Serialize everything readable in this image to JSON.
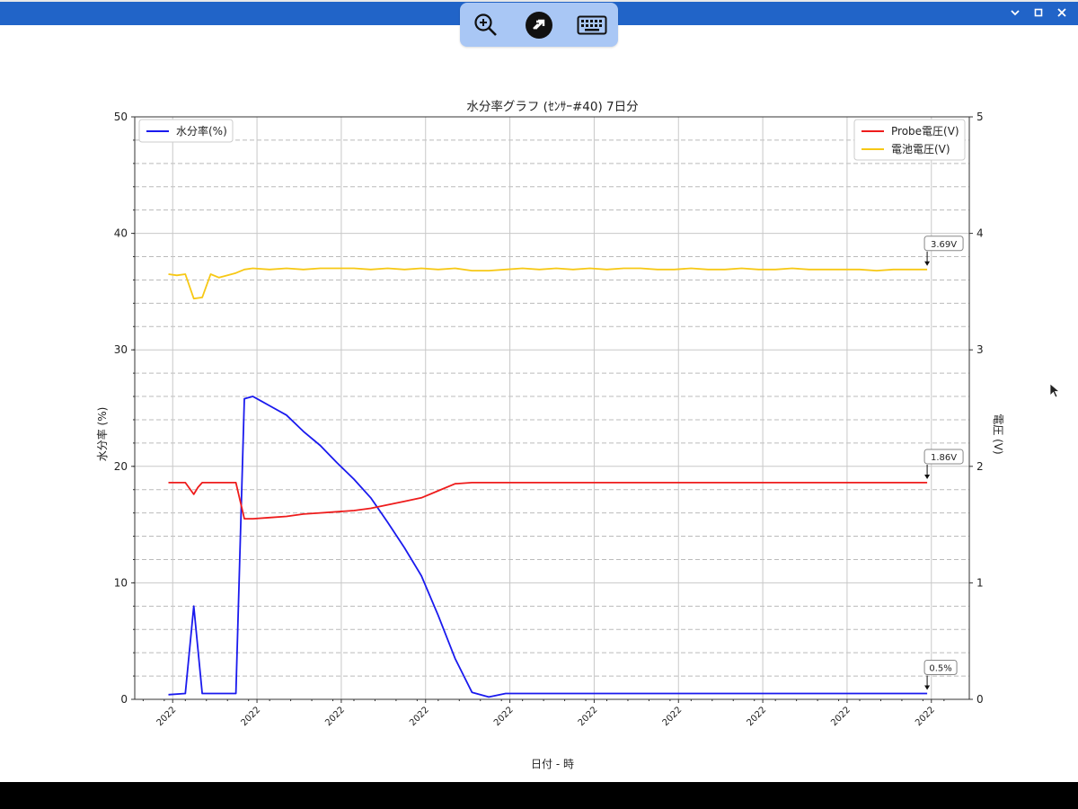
{
  "window": {
    "controls": [
      "minimize",
      "maximize",
      "close"
    ]
  },
  "toolbar": {
    "icons": [
      "zoom-in-icon",
      "remote-connect-icon",
      "keyboard-icon"
    ],
    "accent": "#a9c7f5"
  },
  "colors": {
    "titlebar": "#2164c8",
    "moisture": "#1a1aee",
    "probe": "#ee1c1c",
    "battery": "#f7c815"
  },
  "chart_data": {
    "type": "line",
    "title": "水分率グラフ (ｾﾝｻｰ#40) 7日分",
    "xlabel": "日付 - 時",
    "ylabel_left": "水分率 (%)",
    "ylabel_right": "電圧 (V)",
    "ylim_left": [
      0,
      50
    ],
    "ylim_right": [
      0,
      5
    ],
    "yticks_left": [
      "0",
      "10",
      "20",
      "30",
      "40",
      "50"
    ],
    "yticks_right": [
      "0",
      "1",
      "2",
      "3",
      "4",
      "5"
    ],
    "xticks": [
      "2022",
      "2022",
      "2022",
      "2022",
      "2022",
      "2022",
      "2022",
      "2022",
      "2022",
      "2022"
    ],
    "xticks_pos": [
      0.5,
      10.5,
      20.5,
      30.5,
      40.5,
      50.5,
      60.5,
      70.5,
      80.5,
      90.5
    ],
    "xlim": [
      -4,
      95
    ],
    "grid": true,
    "legend_left": {
      "placement": "top-left",
      "entries": [
        "水分率(%)"
      ]
    },
    "legend_right": {
      "placement": "top-right",
      "entries": [
        "Probe電圧(V)",
        "電池電圧(V)"
      ]
    },
    "annotations": [
      {
        "text": "3.69V",
        "series": "battery"
      },
      {
        "text": "1.86V",
        "series": "probe"
      },
      {
        "text": "0.5%",
        "series": "moisture"
      }
    ],
    "series": [
      {
        "name": "水分率(%)",
        "axis": "left",
        "color": "#1a1aee",
        "x": [
          0,
          2,
          3,
          4,
          5,
          8,
          9,
          10,
          11,
          12,
          14,
          16,
          18,
          20,
          22,
          24,
          26,
          28,
          30,
          32,
          34,
          36,
          38,
          40,
          42,
          43,
          44,
          45,
          46,
          48,
          50,
          54,
          58,
          62,
          66,
          70,
          74,
          78,
          82,
          86,
          90
        ],
        "y": [
          0.4,
          0.5,
          8,
          0.5,
          0.5,
          0.5,
          25.8,
          26.0,
          25.6,
          25.2,
          24.4,
          23.0,
          21.8,
          20.3,
          18.9,
          17.3,
          15.2,
          13.0,
          10.6,
          7.2,
          3.5,
          0.6,
          0.2,
          0.5,
          0.5,
          0.5,
          0.5,
          0.5,
          0.5,
          0.5,
          0.5,
          0.5,
          0.5,
          0.5,
          0.5,
          0.5,
          0.5,
          0.5,
          0.5,
          0.5,
          0.5
        ]
      },
      {
        "name": "Probe電圧(V)",
        "axis": "right",
        "color": "#ee1c1c",
        "x": [
          0,
          1,
          2,
          3,
          3.5,
          4,
          5,
          6,
          7,
          8,
          9,
          10,
          12,
          14,
          16,
          18,
          20,
          22,
          24,
          26,
          28,
          30,
          32,
          34,
          36,
          38,
          40,
          45,
          50,
          60,
          70,
          80,
          90
        ],
        "y": [
          1.86,
          1.86,
          1.86,
          1.76,
          1.82,
          1.86,
          1.86,
          1.86,
          1.86,
          1.86,
          1.55,
          1.55,
          1.56,
          1.57,
          1.59,
          1.6,
          1.61,
          1.62,
          1.64,
          1.67,
          1.7,
          1.73,
          1.79,
          1.85,
          1.86,
          1.86,
          1.86,
          1.86,
          1.86,
          1.86,
          1.86,
          1.86,
          1.86
        ]
      },
      {
        "name": "電池電圧(V)",
        "axis": "right",
        "color": "#f7c815",
        "x": [
          0,
          1,
          2,
          3,
          4,
          5,
          6,
          8,
          9,
          10,
          12,
          14,
          16,
          18,
          20,
          22,
          24,
          26,
          28,
          30,
          32,
          34,
          36,
          38,
          40,
          42,
          44,
          46,
          48,
          50,
          52,
          54,
          56,
          58,
          60,
          62,
          64,
          66,
          68,
          70,
          72,
          74,
          76,
          78,
          80,
          82,
          84,
          86,
          88,
          90
        ],
        "y": [
          3.65,
          3.64,
          3.65,
          3.44,
          3.45,
          3.65,
          3.62,
          3.66,
          3.69,
          3.7,
          3.69,
          3.7,
          3.69,
          3.7,
          3.7,
          3.7,
          3.69,
          3.7,
          3.69,
          3.7,
          3.69,
          3.7,
          3.68,
          3.68,
          3.69,
          3.7,
          3.69,
          3.7,
          3.69,
          3.7,
          3.69,
          3.7,
          3.7,
          3.69,
          3.69,
          3.7,
          3.69,
          3.69,
          3.7,
          3.69,
          3.69,
          3.7,
          3.69,
          3.69,
          3.69,
          3.69,
          3.68,
          3.69,
          3.69,
          3.69
        ]
      }
    ]
  }
}
